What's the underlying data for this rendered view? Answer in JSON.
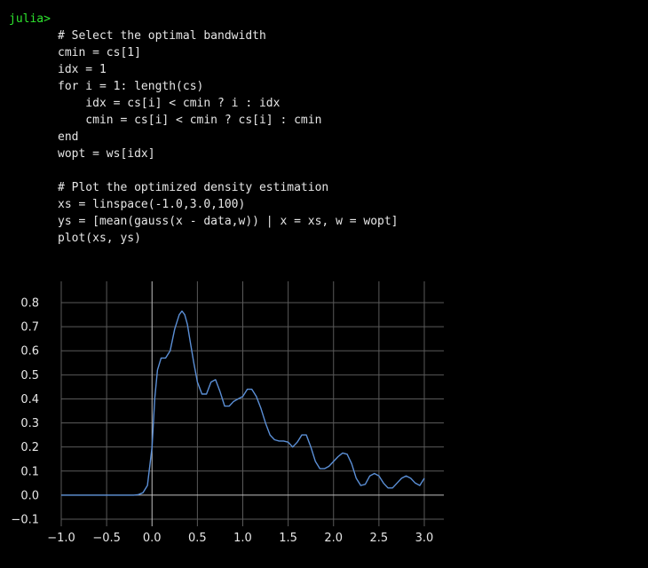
{
  "terminal": {
    "prompt": "julia>",
    "code_lines": [
      "# Select the optimal bandwidth",
      "cmin = cs[1]",
      "idx = 1",
      "for i = 1: length(cs)",
      "    idx = cs[i] < cmin ? i : idx",
      "    cmin = cs[i] < cmin ? cs[i] : cmin",
      "end",
      "wopt = ws[idx]",
      "",
      "# Plot the optimized density estimation",
      "xs = linspace(-1.0,3.0,100)",
      "ys = [mean(gauss(x - data,w)) | x = xs, w = wopt]",
      "plot(xs, ys)"
    ],
    "prompt_color": "#2ee52e",
    "text_color": "#e6e6e6"
  },
  "chart_data": {
    "type": "line",
    "title": "",
    "xlabel": "",
    "ylabel": "",
    "xlim": [
      -1.0,
      3.0
    ],
    "ylim": [
      -0.1,
      0.8
    ],
    "xticks": [
      "−1.0",
      "−0.5",
      "0.0",
      "0.5",
      "1.0",
      "1.5",
      "2.0",
      "2.5",
      "3.0"
    ],
    "xtick_values": [
      -1.0,
      -0.5,
      0.0,
      0.5,
      1.0,
      1.5,
      2.0,
      2.5,
      3.0
    ],
    "yticks": [
      "0.8",
      "0.7",
      "0.6",
      "0.5",
      "0.4",
      "0.3",
      "0.2",
      "0.1",
      "0.0",
      "−0.1"
    ],
    "ytick_values": [
      0.8,
      0.7,
      0.6,
      0.5,
      0.4,
      0.3,
      0.2,
      0.1,
      0.0,
      -0.1
    ],
    "grid": true,
    "line_color": "#5b8fd6",
    "grid_color": "#5a5a5a",
    "axis_color": "#bfbfbf",
    "series": [
      {
        "x": [
          -1.0,
          -0.8,
          -0.6,
          -0.4,
          -0.3,
          -0.2,
          -0.15,
          -0.1,
          -0.05,
          0.0,
          0.03,
          0.06,
          0.1,
          0.15,
          0.2,
          0.25,
          0.3,
          0.33,
          0.36,
          0.39,
          0.42,
          0.46,
          0.5,
          0.55,
          0.6,
          0.65,
          0.7,
          0.75,
          0.8,
          0.85,
          0.9,
          0.95,
          1.0,
          1.05,
          1.1,
          1.15,
          1.2,
          1.25,
          1.3,
          1.35,
          1.4,
          1.45,
          1.5,
          1.55,
          1.6,
          1.65,
          1.7,
          1.75,
          1.8,
          1.85,
          1.9,
          1.95,
          2.0,
          2.05,
          2.1,
          2.15,
          2.2,
          2.25,
          2.3,
          2.35,
          2.4,
          2.45,
          2.5,
          2.55,
          2.6,
          2.65,
          2.7,
          2.75,
          2.8,
          2.85,
          2.9,
          2.95,
          3.0
        ],
        "y": [
          0.0,
          0.0,
          0.0,
          0.0,
          0.0,
          0.0,
          0.002,
          0.01,
          0.04,
          0.2,
          0.4,
          0.52,
          0.57,
          0.57,
          0.6,
          0.69,
          0.75,
          0.765,
          0.75,
          0.71,
          0.64,
          0.55,
          0.47,
          0.42,
          0.42,
          0.47,
          0.48,
          0.43,
          0.37,
          0.37,
          0.39,
          0.4,
          0.41,
          0.44,
          0.44,
          0.41,
          0.36,
          0.3,
          0.25,
          0.23,
          0.225,
          0.225,
          0.22,
          0.2,
          0.22,
          0.25,
          0.25,
          0.2,
          0.14,
          0.11,
          0.11,
          0.12,
          0.14,
          0.16,
          0.175,
          0.17,
          0.13,
          0.07,
          0.04,
          0.045,
          0.08,
          0.09,
          0.08,
          0.05,
          0.03,
          0.03,
          0.05,
          0.07,
          0.08,
          0.07,
          0.05,
          0.04,
          0.07
        ]
      }
    ]
  }
}
